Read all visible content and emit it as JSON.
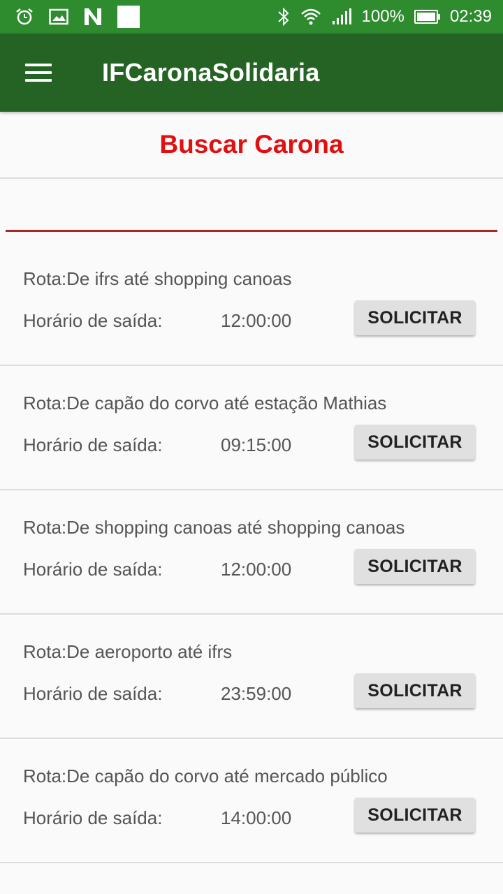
{
  "status_bar": {
    "battery": "100%",
    "time": "02:39",
    "icons": [
      "alarm-icon",
      "image-icon",
      "n-icon",
      "notification-square",
      "bluetooth-icon",
      "wifi-icon",
      "signal-icon",
      "battery-icon"
    ]
  },
  "app_bar": {
    "title": "IFCaronaSolidaria",
    "menu_icon": "hamburger-menu-icon"
  },
  "page": {
    "title": "Buscar Carona",
    "search_value": ""
  },
  "colors": {
    "status_bar": "#2e8b2e",
    "app_bar": "#256324",
    "title_red": "#e01010",
    "input_underline": "#a52a2a"
  },
  "rides": [
    {
      "route": "Rota:De ifrs até shopping canoas",
      "time_label": "Horário de saída:",
      "time": "12:00:00",
      "button": "SOLICITAR"
    },
    {
      "route": "Rota:De capão do corvo até estação Mathias",
      "time_label": "Horário de saída:",
      "time": "09:15:00",
      "button": "SOLICITAR"
    },
    {
      "route": "Rota:De shopping canoas até shopping canoas",
      "time_label": "Horário de saída:",
      "time": "12:00:00",
      "button": "SOLICITAR"
    },
    {
      "route": "Rota:De aeroporto até ifrs",
      "time_label": "Horário de saída:",
      "time": "23:59:00",
      "button": "SOLICITAR"
    },
    {
      "route": "Rota:De capão do corvo até mercado público",
      "time_label": "Horário de saída:",
      "time": "14:00:00",
      "button": "SOLICITAR"
    }
  ]
}
